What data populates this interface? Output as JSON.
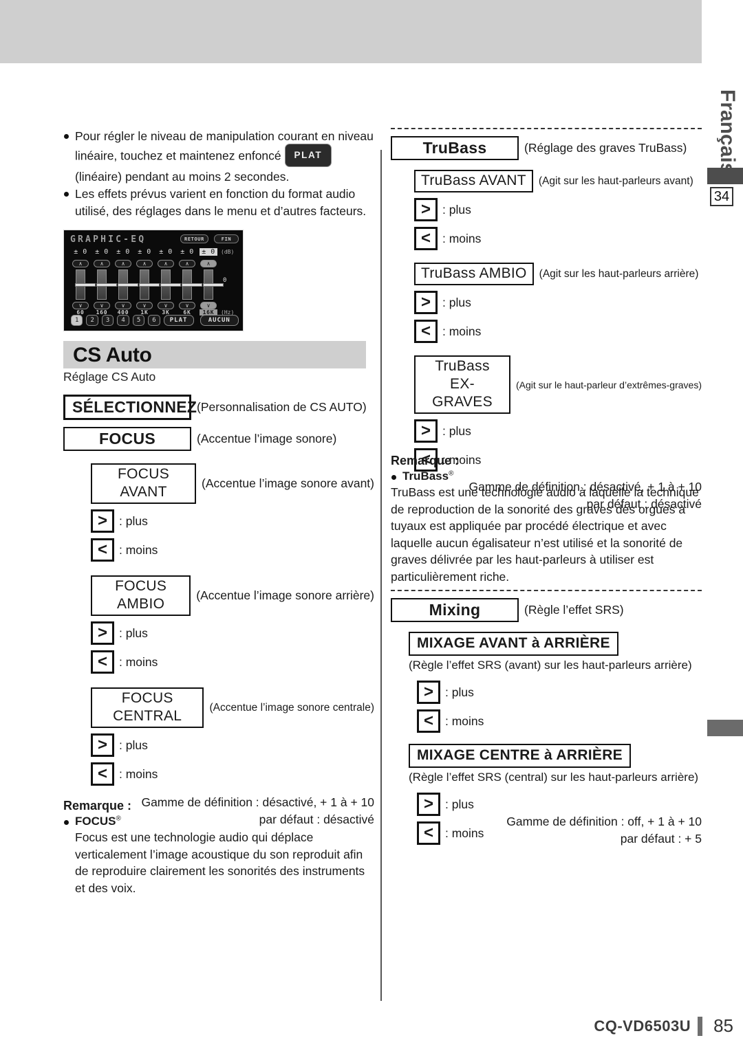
{
  "meta": {
    "language_tab": "Français",
    "chapter_number": "34",
    "footer_model": "CQ-VD6503U",
    "footer_page": "85"
  },
  "intro_bullets": [
    {
      "text_before": "Pour régler le niveau de manipulation courant en niveau linéaire, touchez et maintenez enfoncé",
      "inline_button": "PLAT",
      "text_after": "(linéaire) pendant au moins 2 secondes."
    },
    {
      "text_before": "Les effets prévus varient en fonction du format audio utilisé, des réglages dans le menu et d’autres facteurs.",
      "inline_button": "",
      "text_after": ""
    }
  ],
  "eq_screen": {
    "title": "GRAPHIC-EQ",
    "btn_retour": "RETOUR",
    "btn_fin": "FIN",
    "unit_db": "(dB)",
    "unit_hz": "(Hz)",
    "center_zero": "0",
    "values": [
      "± 0",
      "± 0",
      "± 0",
      "± 0",
      "± 0",
      "± 0",
      "± 0"
    ],
    "frequencies": [
      "60",
      "160",
      "400",
      "1K",
      "3K",
      "6K",
      "16K"
    ],
    "up_glyph": "∧",
    "down_glyph": "∨",
    "selected_band_index": 6,
    "presets": [
      "1",
      "2",
      "3",
      "4",
      "5",
      "6"
    ],
    "selected_preset_index": 0,
    "preset_plat": "PLAT",
    "preset_aucun": "AUCUN"
  },
  "section": {
    "heading": "CS Auto",
    "subheading": "Réglage CS Auto"
  },
  "left_column": {
    "select_key": "SÉLECTIONNEZ",
    "select_desc": "(Personnalisation de CS AUTO)",
    "focus_key": "FOCUS",
    "focus_desc": "(Accentue l’image sonore)",
    "items": [
      {
        "key": "FOCUS AVANT",
        "desc": "(Accentue l’image sonore avant)",
        "plus_glyph": ">",
        "plus_label": ": plus",
        "minus_glyph": "<",
        "minus_label": ": moins"
      },
      {
        "key": "FOCUS AMBIO",
        "desc": "(Accentue l’image sonore arrière)",
        "plus_glyph": ">",
        "plus_label": ": plus",
        "minus_glyph": "<",
        "minus_label": ": moins"
      },
      {
        "key": "FOCUS CENTRAL",
        "desc": "(Accentue l’image sonore centrale)",
        "plus_glyph": ">",
        "plus_label": ": plus",
        "minus_glyph": "<",
        "minus_label": ": moins"
      }
    ],
    "range_line1": "Gamme de définition : désactivé, + 1 à + 10",
    "range_line2": "par défaut : désactivé",
    "remarque_title": "Remarque :",
    "remarque_item": "FOCUS",
    "remarque_item_sup": "®",
    "remarque_body": "Focus est une technologie audio qui déplace verticalement l’image acoustique du son reproduit afin de reproduire clairement les sonorités des instruments et des voix."
  },
  "right_column": {
    "trubass": {
      "key": "TruBass",
      "desc": "(Réglage des graves TruBass)",
      "items": [
        {
          "key": "TruBass AVANT",
          "desc": "(Agit sur les haut-parleurs avant)",
          "plus_glyph": ">",
          "plus_label": ": plus",
          "minus_glyph": "<",
          "minus_label": ": moins"
        },
        {
          "key": "TruBass AMBIO",
          "desc": "(Agit sur les haut-parleurs arrière)",
          "plus_glyph": ">",
          "plus_label": ": plus",
          "minus_glyph": "<",
          "minus_label": ": moins"
        },
        {
          "key": "TruBass EX-GRAVES",
          "desc": "(Agit sur le haut-parleur d’extrêmes-graves)",
          "plus_glyph": ">",
          "plus_label": ": plus",
          "minus_glyph": "<",
          "minus_label": ": moins"
        }
      ],
      "range_line1": "Gamme de définition : désactivé, + 1 à + 10",
      "range_line2": "par défaut : désactivé",
      "remarque_title": "Remarque :",
      "remarque_item": "TruBass",
      "remarque_item_sup": "®",
      "remarque_body": "TruBass est une technologie audio à laquelle la technique de reproduction de la sonorité des graves des orgues à tuyaux est appliquée par procédé électrique et avec laquelle aucun égalisateur n’est utilisé et la sonorité de graves délivrée par les haut-parleurs à utiliser est particulièrement riche."
    },
    "mixing": {
      "key": "Mixing",
      "desc": "(Règle l’effet SRS)",
      "items": [
        {
          "key": "MIXAGE AVANT à ARRIÈRE",
          "desc": "(Règle l’effet SRS (avant) sur les haut-parleurs arrière)",
          "plus_glyph": ">",
          "plus_label": ": plus",
          "minus_glyph": "<",
          "minus_label": ": moins"
        },
        {
          "key": "MIXAGE CENTRE à ARRIÈRE",
          "desc": "(Règle l’effet SRS (central) sur les haut-parleurs arrière)",
          "plus_glyph": ">",
          "plus_label": ": plus",
          "minus_glyph": "<",
          "minus_label": ": moins"
        }
      ],
      "range_line1": "Gamme de définition : off, + 1 à + 10",
      "range_line2": "par défaut : + 5"
    }
  }
}
